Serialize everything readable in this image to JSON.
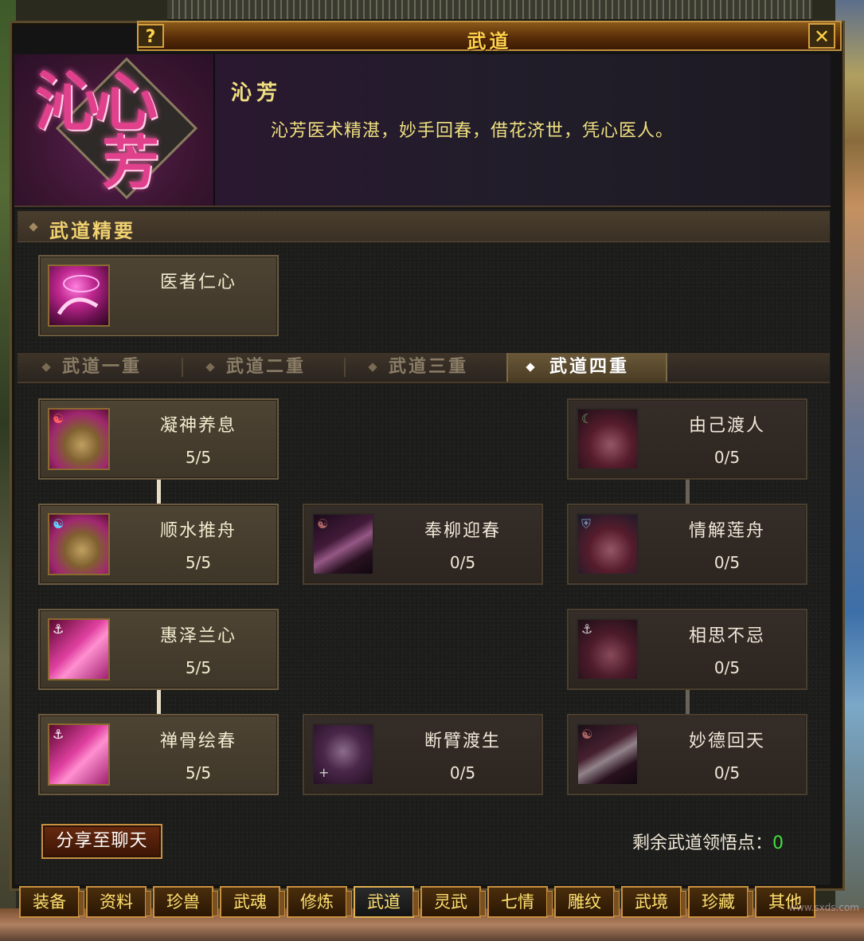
{
  "window": {
    "title": "武道",
    "help_label": "?",
    "close_label": "✕"
  },
  "character": {
    "emblem_text_1": "沁心",
    "emblem_text_2": "芳",
    "name": "沁芳",
    "description": "沁芳医术精湛，妙手回春，借花济世，凭心医人。"
  },
  "essentials": {
    "title": "武道精要",
    "skill": {
      "name": "医者仁心",
      "icon": "healer-heart-icon"
    }
  },
  "tiers": [
    {
      "label": "武道一重",
      "active": false
    },
    {
      "label": "武道二重",
      "active": false
    },
    {
      "label": "武道三重",
      "active": false
    },
    {
      "label": "武道四重",
      "active": true
    }
  ],
  "skills": {
    "s1": {
      "name": "凝神养息",
      "level": "5/5",
      "icon": "turtle-shell-icon"
    },
    "s2": {
      "name": "顺水推舟",
      "level": "5/5",
      "icon": "turtle-shell-water-icon"
    },
    "s3": {
      "name": "奉柳迎春",
      "level": "0/5",
      "icon": "willow-icon"
    },
    "s4": {
      "name": "惠泽兰心",
      "level": "5/5",
      "icon": "orchid-heart-icon"
    },
    "s5": {
      "name": "禅骨绘春",
      "level": "5/5",
      "icon": "painted-spring-icon"
    },
    "s6": {
      "name": "断臂渡生",
      "level": "0/5",
      "icon": "severed-arm-icon"
    },
    "s7": {
      "name": "由己渡人",
      "level": "0/5",
      "icon": "ferry-self-icon"
    },
    "s8": {
      "name": "情解莲舟",
      "level": "0/5",
      "icon": "lotus-boat-icon"
    },
    "s9": {
      "name": "相思不忌",
      "level": "0/5",
      "icon": "longing-icon"
    },
    "s10": {
      "name": "妙德回天",
      "level": "0/5",
      "icon": "virtue-icon"
    }
  },
  "share_button": "分享至聊天",
  "points": {
    "label": "剩余武道领悟点：",
    "value": "0"
  },
  "bottom_tabs": [
    "装备",
    "资料",
    "珍兽",
    "武魂",
    "修炼",
    "武道",
    "灵武",
    "七情",
    "雕纹",
    "武境",
    "珍藏",
    "其他"
  ],
  "bottom_tab_active": "武道",
  "watermark": "www.sxds.com"
}
